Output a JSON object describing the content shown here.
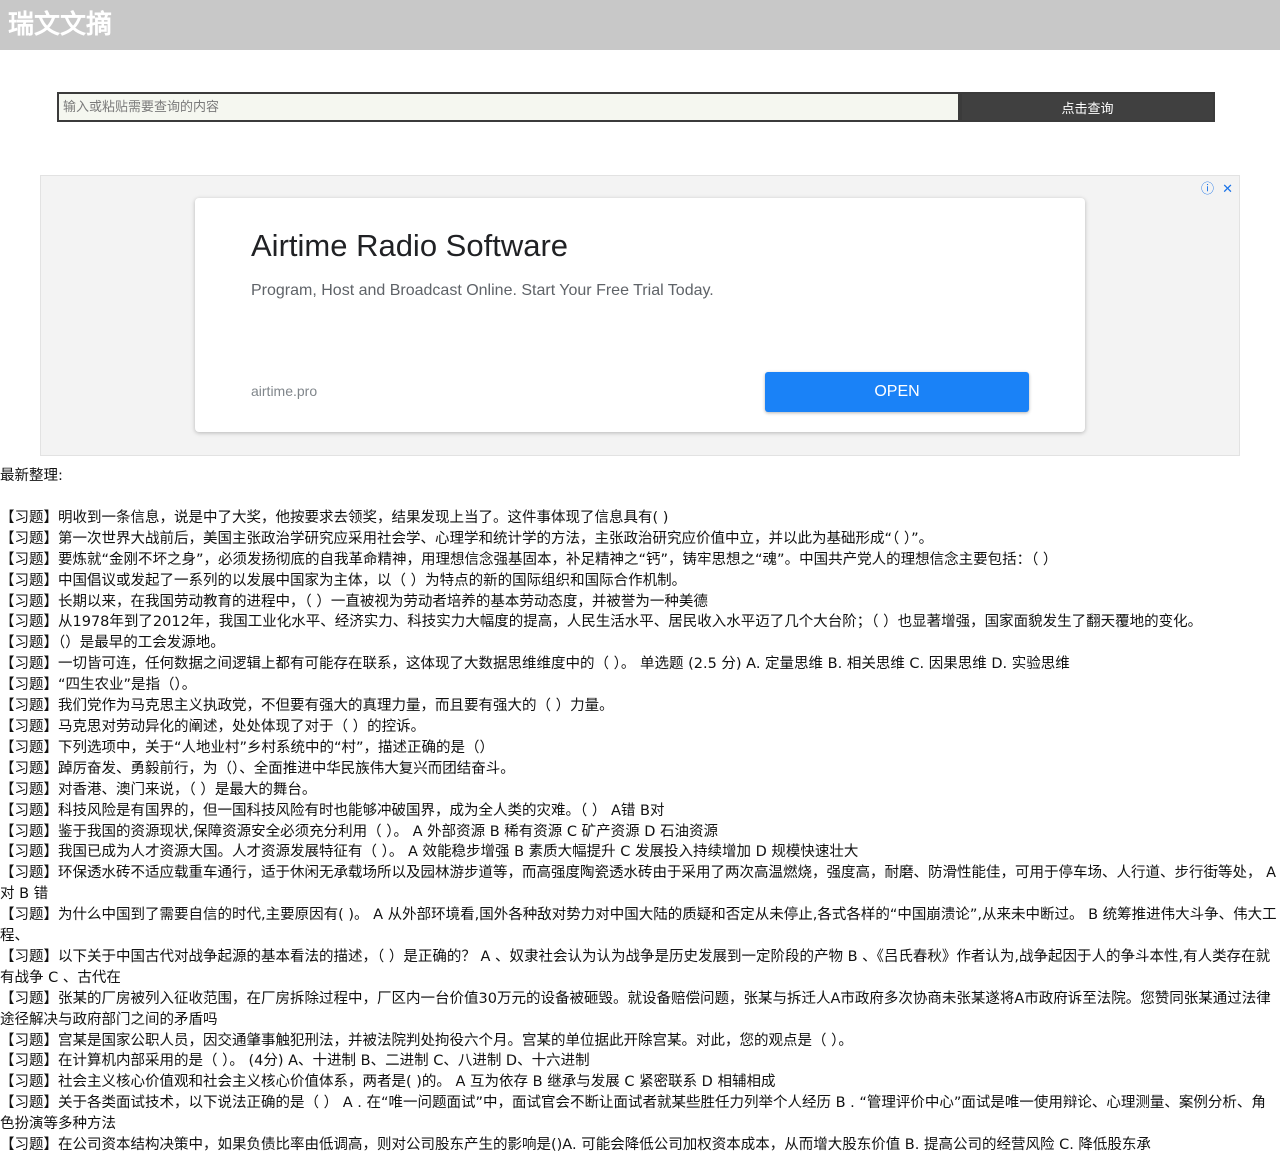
{
  "header": {
    "title": "瑞文文摘"
  },
  "search": {
    "placeholder": "输入或粘贴需要查询的内容",
    "button": "点击查询"
  },
  "ad": {
    "headline": "Airtime Radio Software",
    "description": "Program, Host and Broadcast Online. Start Your Free Trial Today.",
    "domain": "airtime.pro",
    "cta": "OPEN",
    "info_glyph": "ⓘ",
    "close_glyph": "✕"
  },
  "content": {
    "section_label": "最新整理:",
    "items": [
      "【习题】明收到一条信息，说是中了大奖，他按要求去领奖，结果发现上当了。这件事体现了信息具有( )",
      "【习题】第一次世界大战前后，美国主张政治学研究应采用社会学、心理学和统计学的方法，主张政治研究应价值中立，并以此为基础形成“（ ）”。",
      "【习题】要炼就“金刚不坏之身”，必须发扬彻底的自我革命精神，用理想信念强基固本，补足精神之“钙”，铸牢思想之“魂”。中国共产党人的理想信念主要包括：（ ）",
      "【习题】中国倡议或发起了一系列的以发展中国家为主体，以（ ）为特点的新的国际组织和国际合作机制。",
      "【习题】长期以来，在我国劳动教育的进程中，（ ）一直被视为劳动者培养的基本劳动态度，并被誉为一种美德",
      "【习题】从1978年到了2012年，我国工业化水平、经济实力、科技实力大幅度的提高，人民生活水平、居民收入水平迈了几个大台阶；（ ）也显著增强，国家面貌发生了翻天覆地的变化。",
      "【习题】（）是最早的工会发源地。",
      "【习题】一切皆可连，任何数据之间逻辑上都有可能存在联系，这体现了大数据思维维度中的（ ）。 单选题 (2.5 分) A. 定量思维 B. 相关思维 C. 因果思维 D. 实验思维",
      "【习题】“四生农业”是指（）。",
      "【习题】我们党作为马克思主义执政党，不但要有强大的真理力量，而且要有强大的（ ）力量。",
      "【习题】马克思对劳动异化的阐述，处处体现了对于（ ）的控诉。",
      "【习题】下列选项中，关于“人地业村”乡村系统中的“村”，描述正确的是（）",
      "【习题】踔厉奋发、勇毅前行，为（）、全面推进中华民族伟大复兴而团结奋斗。",
      "【习题】对香港、澳门来说，（ ）是最大的舞台。",
      "【习题】科技风险是有国界的，但一国科技风险有时也能够冲破国界，成为全人类的灾难。（ ） A错 B对",
      "【习题】鉴于我国的资源现状,保障资源安全必须充分利用（ ）。 A 外部资源 B 稀有资源 C 矿产资源 D 石油资源",
      "【习题】我国已成为人才资源大国。人才资源发展特征有（ ）。 A 效能稳步增强 B 素质大幅提升 C 发展投入持续增加 D 规模快速壮大",
      "【习题】环保透水砖不适应载重车通行，适于休闲无承载场所以及园林游步道等，而高强度陶瓷透水砖由于采用了两次高温燃烧，强度高，耐磨、防滑性能佳，可用于停车场、人行道、步行街等处， A 对 B 错",
      "【习题】为什么中国到了需要自信的时代,主要原因有( )。 A 从外部环境看,国外各种敌对势力对中国大陆的质疑和否定从未停止,各式各样的“中国崩溃论”,从来未中断过。 B 统筹推进伟大斗争、伟大工程、",
      "【习题】以下关于中国古代对战争起源的基本看法的描述，（ ）是正确的？ A 、奴隶社会认为认为战争是历史发展到一定阶段的产物 B 、《吕氏春秋》作者认为,战争起因于人的争斗本性,有人类存在就有战争 C 、古代在",
      "【习题】张某的厂房被列入征收范围，在厂房拆除过程中，厂区内一台价值30万元的设备被砸毁。就设备赔偿问题，张某与拆迁人A市政府多次协商未张某遂将A市政府诉至法院。您赞同张某通过法律途径解决与政府部门之间的矛盾吗",
      "【习题】宫某是国家公职人员，因交通肇事触犯刑法，并被法院判处拘役六个月。宫某的单位据此开除宫某。对此，您的观点是（ ）。",
      "【习题】在计算机内部采用的是（ ）。 (4分) A、十进制 B、二进制 C、八进制 D、十六进制",
      "【习题】社会主义核心价值观和社会主义核心价值体系，两者是( )的。 A 互为依存 B 继承与发展 C 紧密联系 D 相辅相成",
      "【习题】关于各类面试技术，以下说法正确的是（ ） A . 在“唯一问题面试”中，面试官会不断让面试者就某些胜任力列举个人经历 B . “管理评价中心”面试是唯一使用辩论、心理测量、案例分析、角色扮演等多种方法",
      "【习题】在公司资本结构决策中，如果负债比率由低调高，则对公司股东产生的影响是()A. 可能会降低公司加权资本成本，从而增大股东价值 B. 提高公司的经营风险 C. 降低股东承"
    ]
  }
}
